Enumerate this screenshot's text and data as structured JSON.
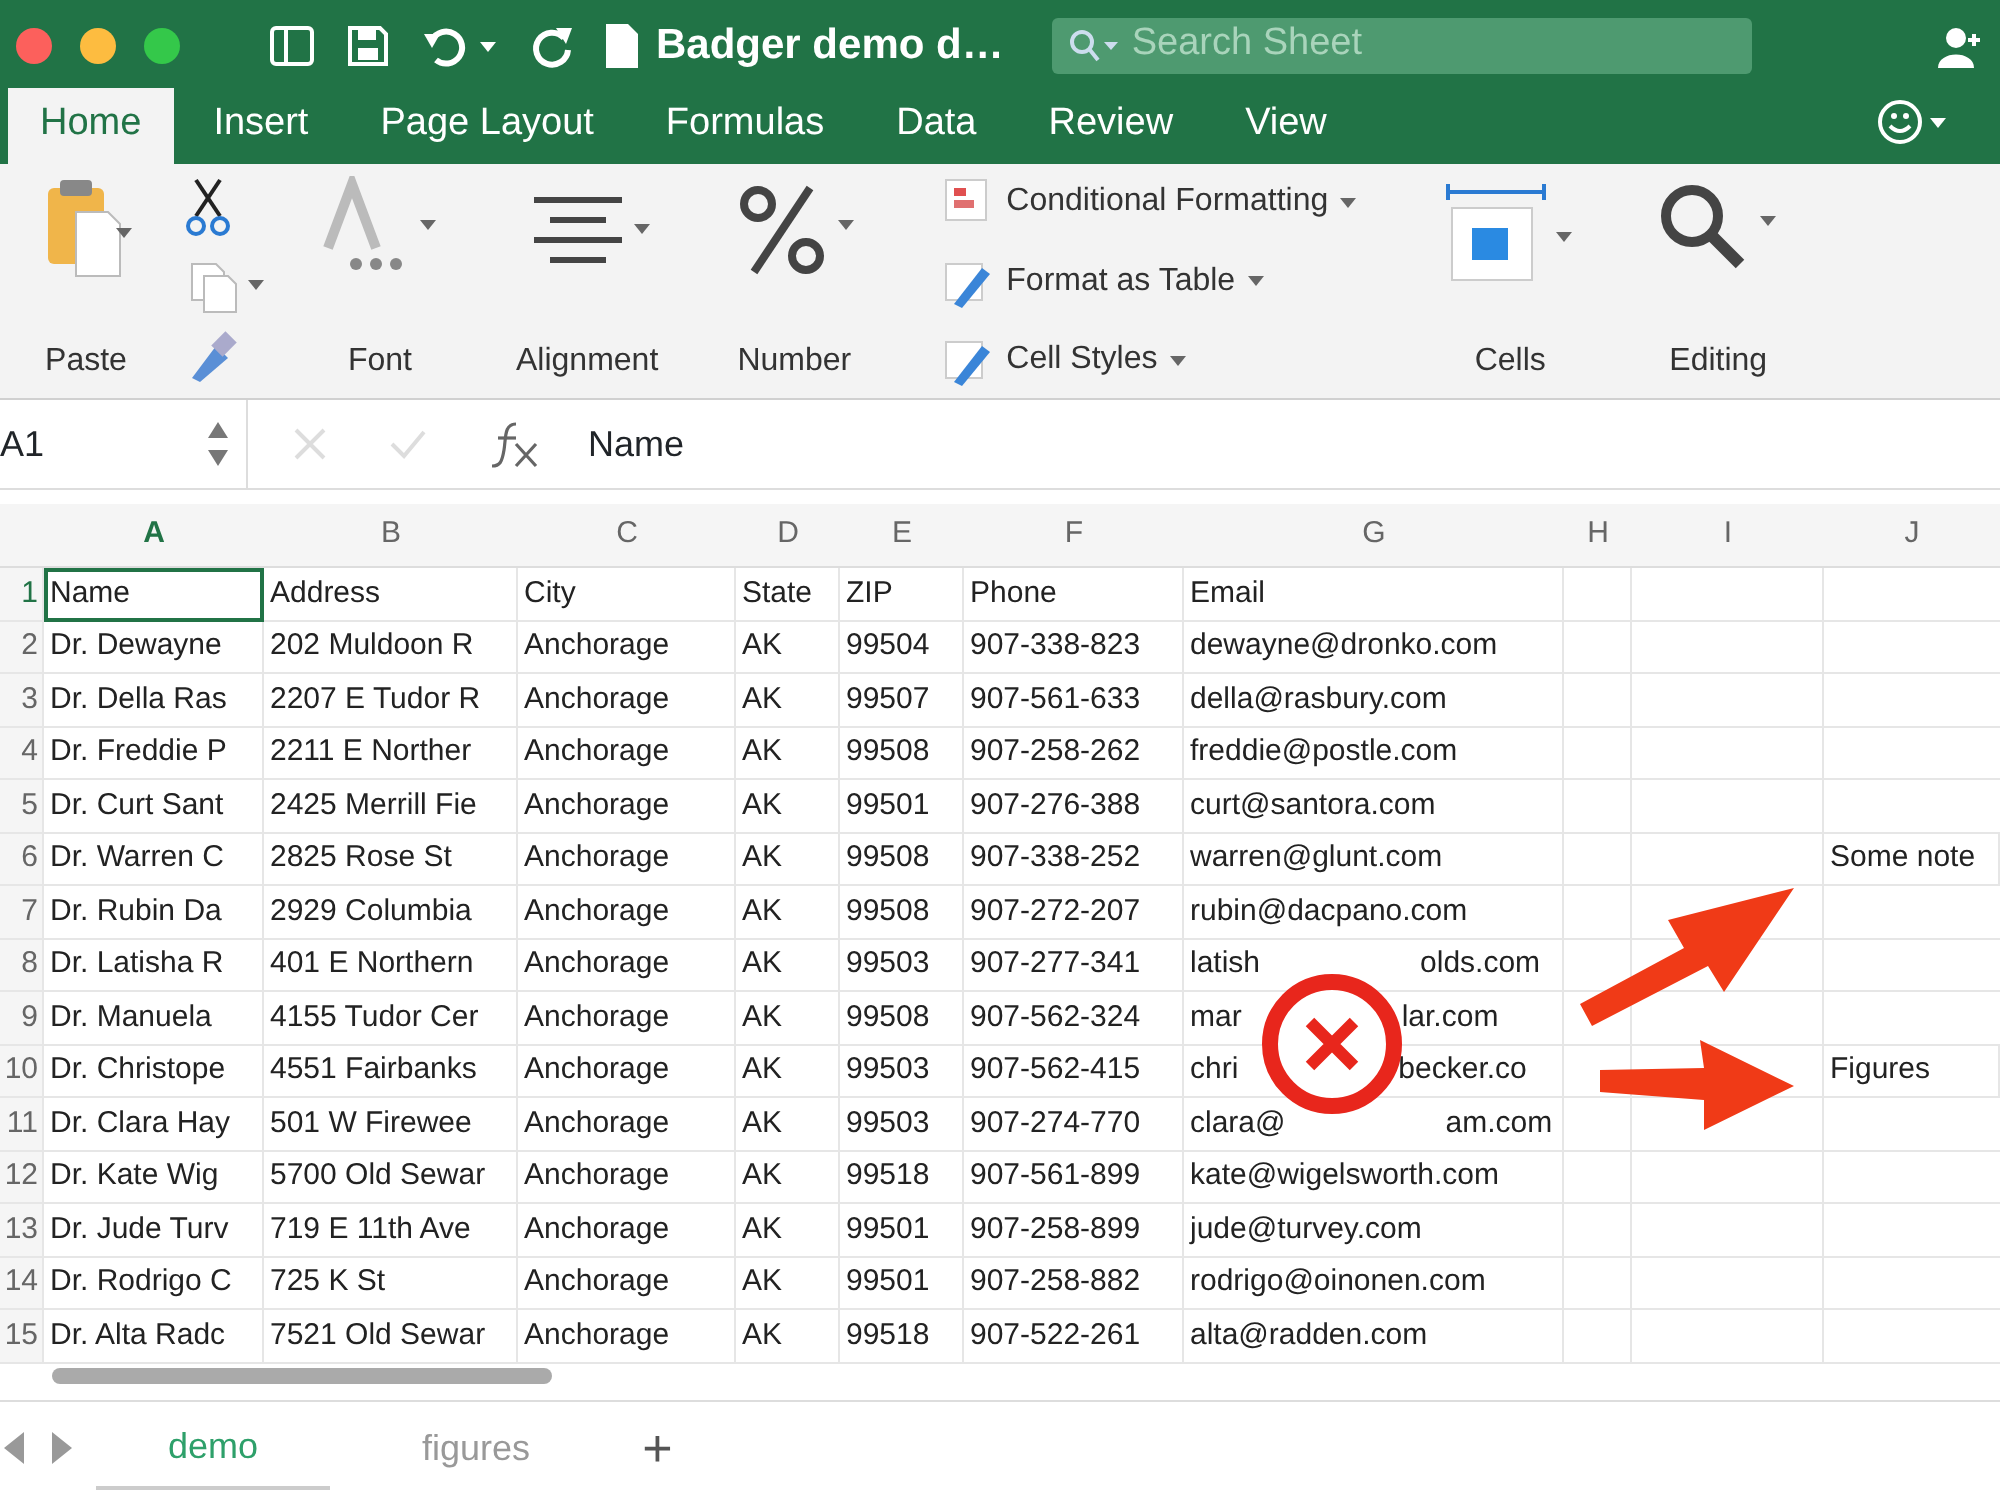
{
  "window": {
    "title": "Badger demo d…",
    "search": {
      "placeholder": "Search Sheet"
    }
  },
  "tabs": [
    {
      "label": "Home",
      "selected": true
    },
    {
      "label": "Insert",
      "selected": false
    },
    {
      "label": "Page Layout",
      "selected": false
    },
    {
      "label": "Formulas",
      "selected": false
    },
    {
      "label": "Data",
      "selected": false
    },
    {
      "label": "Review",
      "selected": false
    },
    {
      "label": "View",
      "selected": false
    }
  ],
  "ribbon": [
    {
      "kind": "paste",
      "label": "Paste"
    },
    {
      "kind": "clipboard"
    },
    {
      "kind": "font",
      "label": "Font"
    },
    {
      "kind": "alignment",
      "label": "Alignment"
    },
    {
      "kind": "number",
      "label": "Number"
    },
    {
      "kind": "styles",
      "items": [
        "Conditional Formatting",
        "Format as Table",
        "Cell Styles"
      ]
    },
    {
      "kind": "cells",
      "label": "Cells"
    },
    {
      "kind": "editing",
      "label": "Editing"
    }
  ],
  "formula_bar": {
    "cell_ref": "A1",
    "value": "Name"
  },
  "columns": [
    {
      "letter": "A",
      "selected": true
    },
    {
      "letter": "B",
      "selected": false
    },
    {
      "letter": "C",
      "selected": false
    },
    {
      "letter": "D",
      "selected": false
    },
    {
      "letter": "E",
      "selected": false
    },
    {
      "letter": "F",
      "selected": false
    },
    {
      "letter": "G",
      "selected": false
    },
    {
      "letter": "H",
      "selected": false
    },
    {
      "letter": "I",
      "selected": false
    },
    {
      "letter": "J",
      "selected": false
    }
  ],
  "rows": [
    {
      "number": "1",
      "selected": true,
      "cells": {
        "A": "Name",
        "B": "Address",
        "C": "City",
        "D": "State",
        "E": "ZIP",
        "F": "Phone",
        "G": "Email"
      }
    },
    {
      "number": "2",
      "selected": false,
      "cells": {
        "A": "Dr. Dewayne",
        "B": "202 Muldoon R",
        "C": "Anchorage",
        "D": "AK",
        "E": "99504",
        "F": "907-338-823",
        "G": "dewayne@dronko.com"
      }
    },
    {
      "number": "3",
      "selected": false,
      "cells": {
        "A": "Dr. Della Ras",
        "B": "2207 E Tudor R",
        "C": "Anchorage",
        "D": "AK",
        "E": "99507",
        "F": "907-561-633",
        "G": "della@rasbury.com"
      }
    },
    {
      "number": "4",
      "selected": false,
      "cells": {
        "A": "Dr. Freddie P",
        "B": "2211 E Norther",
        "C": "Anchorage",
        "D": "AK",
        "E": "99508",
        "F": "907-258-262",
        "G": "freddie@postle.com"
      }
    },
    {
      "number": "5",
      "selected": false,
      "cells": {
        "A": "Dr. Curt Sant",
        "B": "2425 Merrill Fie",
        "C": "Anchorage",
        "D": "AK",
        "E": "99501",
        "F": "907-276-388",
        "G": "curt@santora.com"
      }
    },
    {
      "number": "6",
      "selected": false,
      "cells": {
        "A": "Dr. Warren C",
        "B": "2825 Rose St",
        "C": "Anchorage",
        "D": "AK",
        "E": "99508",
        "F": "907-338-252",
        "G": "warren@glunt.com",
        "J": "Some note"
      }
    },
    {
      "number": "7",
      "selected": false,
      "cells": {
        "A": "Dr. Rubin Da",
        "B": "2929 Columbia",
        "C": "Anchorage",
        "D": "AK",
        "E": "99508",
        "F": "907-272-207",
        "G": "rubin@dacpano.com"
      }
    },
    {
      "number": "8",
      "selected": false,
      "cells": {
        "A": "Dr. Latisha R",
        "B": "401 E Northern",
        "C": "Anchorage",
        "D": "AK",
        "E": "99503",
        "F": "907-277-341",
        "G": [
          "latish",
          "olds.com"
        ]
      }
    },
    {
      "number": "9",
      "selected": false,
      "cells": {
        "A": "Dr. Manuela",
        "B": "4155 Tudor Cer",
        "C": "Anchorage",
        "D": "AK",
        "E": "99508",
        "F": "907-562-324",
        "G": [
          "mar",
          "lar.com"
        ]
      }
    },
    {
      "number": "10",
      "selected": false,
      "cells": {
        "A": "Dr. Christope",
        "B": "4551 Fairbanks",
        "C": "Anchorage",
        "D": "AK",
        "E": "99503",
        "F": "907-562-415",
        "G": [
          "chri",
          "becker.co"
        ],
        "J": "Figures"
      }
    },
    {
      "number": "11",
      "selected": false,
      "cells": {
        "A": "Dr. Clara Hay",
        "B": "501 W Firewee",
        "C": "Anchorage",
        "D": "AK",
        "E": "99503",
        "F": "907-274-770",
        "G": [
          "clara@",
          "am.com"
        ]
      }
    },
    {
      "number": "12",
      "selected": false,
      "cells": {
        "A": "Dr. Kate Wig",
        "B": "5700 Old Sewar",
        "C": "Anchorage",
        "D": "AK",
        "E": "99518",
        "F": "907-561-899",
        "G": "kate@wigelsworth.com"
      }
    },
    {
      "number": "13",
      "selected": false,
      "cells": {
        "A": "Dr. Jude Turv",
        "B": "719 E 11th Ave",
        "C": "Anchorage",
        "D": "AK",
        "E": "99501",
        "F": "907-258-899",
        "G": "jude@turvey.com"
      }
    },
    {
      "number": "14",
      "selected": false,
      "cells": {
        "A": "Dr. Rodrigo C",
        "B": "725 K St",
        "C": "Anchorage",
        "D": "AK",
        "E": "99501",
        "F": "907-258-882",
        "G": "rodrigo@oinonen.com"
      }
    },
    {
      "number": "15",
      "selected": false,
      "cells": {
        "A": "Dr. Alta Radc",
        "B": "7521 Old Sewar",
        "C": "Anchorage",
        "D": "AK",
        "E": "99518",
        "F": "907-522-261",
        "G": "alta@radden.com"
      }
    }
  ],
  "sheet_tabs": [
    {
      "label": "demo",
      "selected": true
    },
    {
      "label": "figures",
      "selected": false
    }
  ],
  "add_sheet": "+"
}
